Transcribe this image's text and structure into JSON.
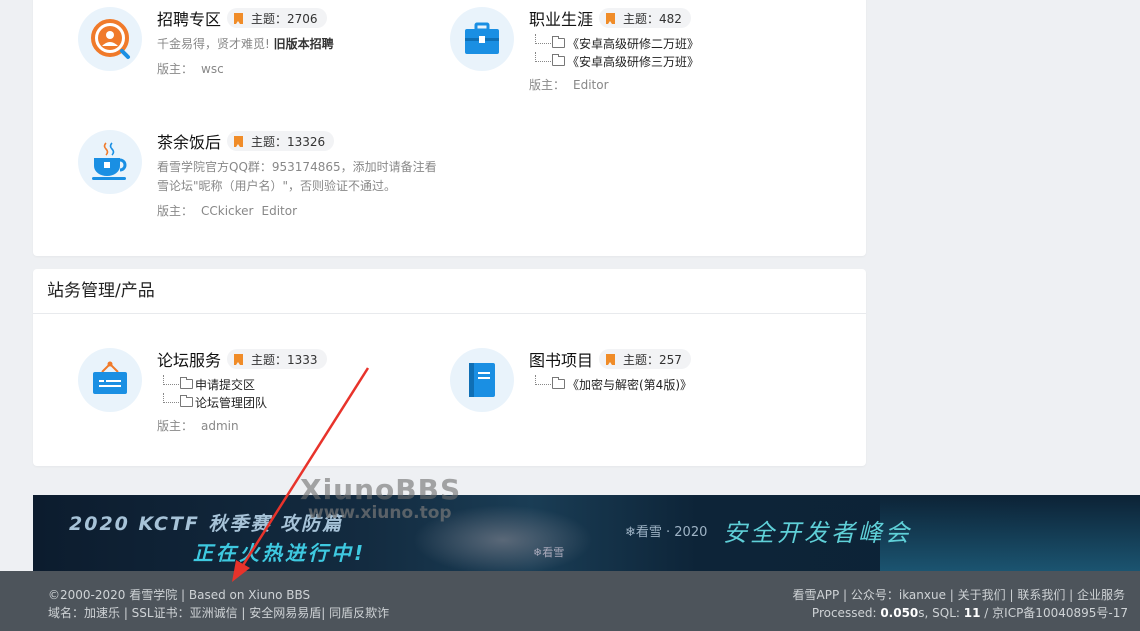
{
  "sections": {
    "mgmt_title": "站务管理/产品"
  },
  "forums": {
    "recruit": {
      "title": "招聘专区",
      "topics": "主题：2706",
      "desc_text": "千金易得，贤才难觅! ",
      "desc_link": "旧版本招聘",
      "mods_label": "版主：",
      "mods": [
        "wsc"
      ]
    },
    "career": {
      "title": "职业生涯",
      "topics": "主题：482",
      "subs": [
        "《安卓高级研修二万班》",
        "《安卓高级研修三万班》"
      ],
      "mods_label": "版主：",
      "mods": [
        "Editor"
      ]
    },
    "tea": {
      "title": "茶余饭后",
      "topics": "主题：13326",
      "desc_line1": "看雪学院官方QQ群：953174865，添加时请备注看",
      "desc_line2": "雪论坛\"昵称（用户名）\"，否则验证不通过。",
      "mods_label": "版主：",
      "mods": [
        "CCkicker",
        "Editor"
      ]
    },
    "service": {
      "title": "论坛服务",
      "topics": "主题：1333",
      "subs": [
        "申请提交区",
        "论坛管理团队"
      ],
      "mods_label": "版主：",
      "mods": [
        "admin"
      ]
    },
    "books": {
      "title": "图书项目",
      "topics": "主题：257",
      "subs": [
        "《加密与解密(第4版)》"
      ]
    }
  },
  "banner": {
    "left_line1": "2020 KCTF 秋季赛  攻防篇",
    "left_line2": "正在火热进行中!",
    "mid_text": "❄看雪",
    "logo_text": "❄看雪 · 2020",
    "right_text": "安全开发者峰会"
  },
  "watermark": {
    "line1": "XiunoBBS",
    "line2": "www.xiuno.top"
  },
  "footer": {
    "copyright": "©2000-2020 看雪学院 | Based on Xiuno BBS",
    "domain_line": "域名：加速乐 | SSL证书：亚洲诚信 | 安全网易易盾| 同盾反欺诈",
    "links": "看雪APP | 公众号：ikanxue | 关于我们 | 联系我们 | 企业服务",
    "processed_label": "Processed: ",
    "processed_value": "0.050",
    "sql_label": "s, SQL: ",
    "sql_value": "11",
    "icp": " / 京ICP备10040895号-17"
  },
  "colors": {
    "bookmark": "#f08c28",
    "icon_blue": "#1a8fe3",
    "icon_orange": "#f07a2a",
    "footer_bg": "#4d545b",
    "annotation_arrow": "#e8332b"
  },
  "icons": [
    "user-search-icon",
    "briefcase-icon",
    "coffee-cup-icon",
    "signboard-icon",
    "book-icon",
    "bookmark-icon",
    "folder-icon"
  ]
}
